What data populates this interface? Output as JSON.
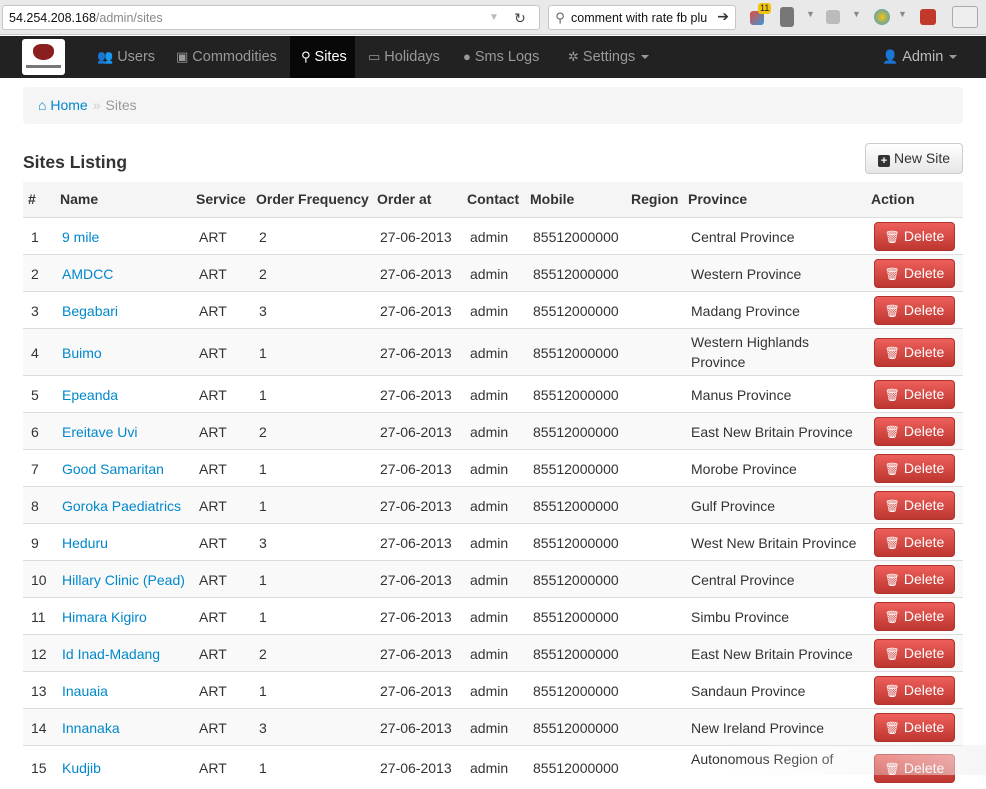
{
  "browser": {
    "url_host": "54.254.208.168",
    "url_path": "/admin/sites",
    "search_text": "comment with rate fb plu",
    "ext_badge": "11"
  },
  "navbar": {
    "items": [
      {
        "label": "Users",
        "icon": "users-icon"
      },
      {
        "label": "Commodities",
        "icon": "briefcase-icon"
      },
      {
        "label": "Sites",
        "icon": "map-marker-icon"
      },
      {
        "label": "Holidays",
        "icon": "calendar-icon"
      },
      {
        "label": "Sms Logs",
        "icon": "comment-icon"
      },
      {
        "label": "Settings",
        "icon": "gear-icon"
      }
    ],
    "user_label": "Admin"
  },
  "breadcrumb": {
    "home": "Home",
    "separator": "»",
    "current": "Sites"
  },
  "page": {
    "title": "Sites Listing",
    "new_button": "New Site"
  },
  "table": {
    "headers": [
      "#",
      "Name",
      "Service",
      "Order Frequency",
      "Order at",
      "Contact",
      "Mobile",
      "Region",
      "Province",
      "Action"
    ],
    "delete_label": "Delete",
    "rows": [
      {
        "num": "1",
        "name": "9 mile",
        "service": "ART",
        "freq": "2",
        "order_at": "27-06-2013",
        "contact": "admin",
        "mobile": "85512000000",
        "region": "",
        "province": "Central Province"
      },
      {
        "num": "2",
        "name": "AMDCC",
        "service": "ART",
        "freq": "2",
        "order_at": "27-06-2013",
        "contact": "admin",
        "mobile": "85512000000",
        "region": "",
        "province": "Western Province"
      },
      {
        "num": "3",
        "name": "Begabari",
        "service": "ART",
        "freq": "3",
        "order_at": "27-06-2013",
        "contact": "admin",
        "mobile": "85512000000",
        "region": "",
        "province": "Madang Province"
      },
      {
        "num": "4",
        "name": "Buimo",
        "service": "ART",
        "freq": "1",
        "order_at": "27-06-2013",
        "contact": "admin",
        "mobile": "85512000000",
        "region": "",
        "province": "Western Highlands Province"
      },
      {
        "num": "5",
        "name": "Epeanda",
        "service": "ART",
        "freq": "1",
        "order_at": "27-06-2013",
        "contact": "admin",
        "mobile": "85512000000",
        "region": "",
        "province": "Manus Province"
      },
      {
        "num": "6",
        "name": "Ereitave Uvi",
        "service": "ART",
        "freq": "2",
        "order_at": "27-06-2013",
        "contact": "admin",
        "mobile": "85512000000",
        "region": "",
        "province": "East New Britain Province"
      },
      {
        "num": "7",
        "name": "Good Samaritan",
        "service": "ART",
        "freq": "1",
        "order_at": "27-06-2013",
        "contact": "admin",
        "mobile": "85512000000",
        "region": "",
        "province": "Morobe Province"
      },
      {
        "num": "8",
        "name": "Goroka Paediatrics",
        "service": "ART",
        "freq": "1",
        "order_at": "27-06-2013",
        "contact": "admin",
        "mobile": "85512000000",
        "region": "",
        "province": "Gulf Province"
      },
      {
        "num": "9",
        "name": "Heduru",
        "service": "ART",
        "freq": "3",
        "order_at": "27-06-2013",
        "contact": "admin",
        "mobile": "85512000000",
        "region": "",
        "province": "West New Britain Province"
      },
      {
        "num": "10",
        "name": "Hillary Clinic (Pead)",
        "service": "ART",
        "freq": "1",
        "order_at": "27-06-2013",
        "contact": "admin",
        "mobile": "85512000000",
        "region": "",
        "province": "Central Province"
      },
      {
        "num": "11",
        "name": "Himara Kigiro",
        "service": "ART",
        "freq": "1",
        "order_at": "27-06-2013",
        "contact": "admin",
        "mobile": "85512000000",
        "region": "",
        "province": "Simbu Province"
      },
      {
        "num": "12",
        "name": "Id Inad-Madang",
        "service": "ART",
        "freq": "2",
        "order_at": "27-06-2013",
        "contact": "admin",
        "mobile": "85512000000",
        "region": "",
        "province": "East New Britain Province"
      },
      {
        "num": "13",
        "name": "Inauaia",
        "service": "ART",
        "freq": "1",
        "order_at": "27-06-2013",
        "contact": "admin",
        "mobile": "85512000000",
        "region": "",
        "province": "Sandaun Province"
      },
      {
        "num": "14",
        "name": "Innanaka",
        "service": "ART",
        "freq": "3",
        "order_at": "27-06-2013",
        "contact": "admin",
        "mobile": "85512000000",
        "region": "",
        "province": "New Ireland Province"
      },
      {
        "num": "15",
        "name": "Kudjib",
        "service": "ART",
        "freq": "1",
        "order_at": "27-06-2013",
        "contact": "admin",
        "mobile": "85512000000",
        "region": "",
        "province": "Autonomous Region of"
      }
    ]
  },
  "colors": {
    "navbar_bg": "#222222",
    "link": "#0088cc",
    "danger": "#da4f49"
  }
}
